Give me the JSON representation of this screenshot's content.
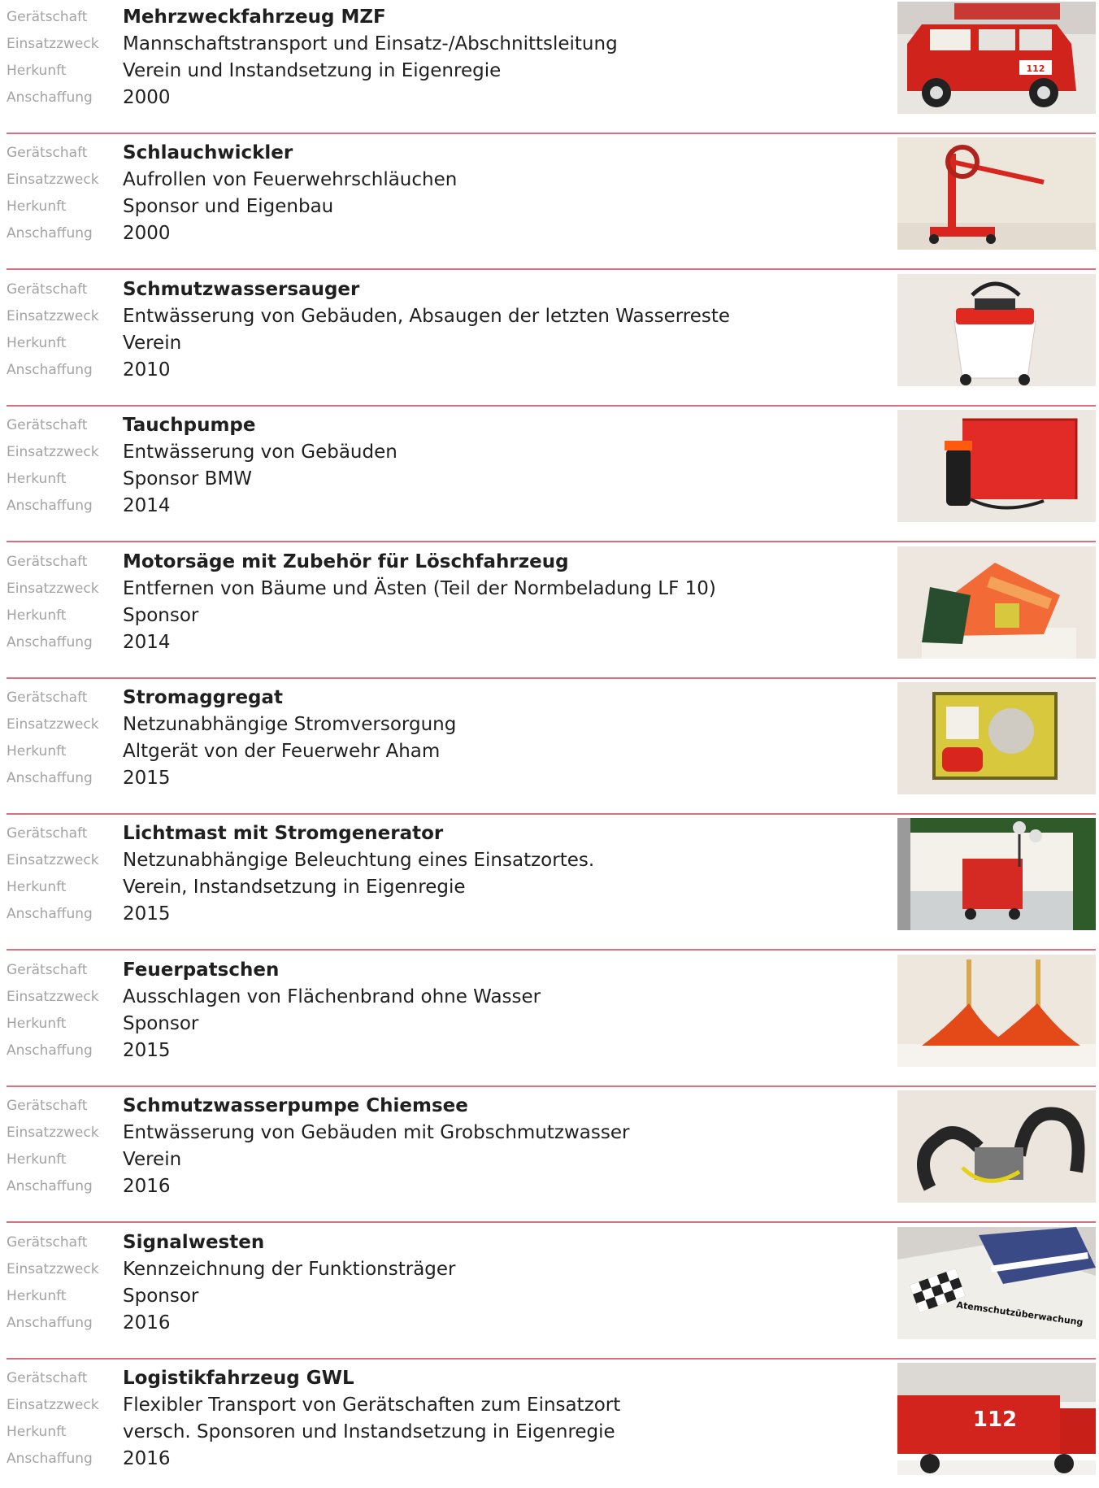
{
  "labels": {
    "item": "Gerätschaft",
    "purpose": "Einsatzzweck",
    "origin": "Herkunft",
    "acquired": "Anschaffung"
  },
  "entries": [
    {
      "name": "Mehrzweckfahrzeug MZF",
      "purpose": "Mannschaftstransport und Einsatz-/Abschnittsleitung",
      "origin": "Verein und Instandsetzung in Eigenregie",
      "year": "2000",
      "photo": "fire-van-photo",
      "photo_lettering": [
        "112"
      ]
    },
    {
      "name": "Schlauchwickler",
      "purpose": "Aufrollen von Feuerwehrschläuchen",
      "origin": "Sponsor und Eigenbau",
      "year": "2000",
      "photo": "hose-reel-photo"
    },
    {
      "name": "Schmutzwassersauger",
      "purpose": "Entwässerung von Gebäuden, Absaugen der letzten Wasserreste",
      "origin": "Verein",
      "year": "2010",
      "photo": "wet-vacuum-photo"
    },
    {
      "name": "Tauchpumpe",
      "purpose": "Entwässerung von Gebäuden",
      "origin": "Sponsor BMW",
      "year": "2014",
      "photo": "submersible-pump-photo"
    },
    {
      "name": "Motorsäge mit Zubehör für Löschfahrzeug",
      "purpose": "Entfernen von Bäume und Ästen (Teil der Normbeladung LF 10)",
      "origin": "Sponsor",
      "year": "2014",
      "photo": "chainsaw-photo"
    },
    {
      "name": "Stromaggregat",
      "purpose": "Netzunabhängige Stromversorgung",
      "origin": "Altgerät von der Feuerwehr Aham",
      "year": "2015",
      "photo": "generator-photo"
    },
    {
      "name": "Lichtmast mit Stromgenerator",
      "purpose": "Netzunabhängige Beleuchtung eines Einsatzortes.",
      "origin": "Verein, Instandsetzung in Eigenregie",
      "year": "2015",
      "photo": "light-mast-photo"
    },
    {
      "name": "Feuerpatschen",
      "purpose": "Ausschlagen von Flächenbrand ohne Wasser",
      "origin": "Sponsor",
      "year": "2015",
      "photo": "fire-beaters-photo"
    },
    {
      "name": "Schmutzwasserpumpe Chiemsee",
      "purpose": "Entwässerung von Gebäuden mit Grobschmutzwasser",
      "origin": "Verein",
      "year": "2016",
      "photo": "sewage-pump-photo"
    },
    {
      "name": "Signalwesten",
      "purpose": "Kennzeichnung der Funktionsträger",
      "origin": "Sponsor",
      "year": "2016",
      "photo": "signal-vests-photo",
      "photo_lettering": [
        "Atemschutzüberwachung"
      ]
    },
    {
      "name": "Logistikfahrzeug GWL",
      "purpose": "Flexibler Transport von Gerätschaften zum Einsatzort",
      "origin": "versch. Sponsoren und Instandsetzung in Eigenregie",
      "year": "2016",
      "photo": "logistics-truck-photo",
      "photo_lettering": [
        "112"
      ]
    }
  ],
  "colors": {
    "separator": "#d9707f",
    "label": "#a3a3a3",
    "text": "#1f1f1f",
    "fire_red": "#d8261f"
  }
}
